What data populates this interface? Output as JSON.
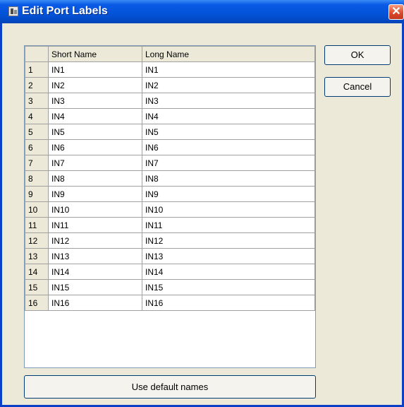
{
  "window": {
    "title": "Edit Port Labels",
    "close_glyph": "✕"
  },
  "table": {
    "headers": {
      "short": "Short Name",
      "long": "Long Name"
    },
    "rows": [
      {
        "num": "1",
        "short": "IN1",
        "long": "IN1"
      },
      {
        "num": "2",
        "short": "IN2",
        "long": "IN2"
      },
      {
        "num": "3",
        "short": "IN3",
        "long": "IN3"
      },
      {
        "num": "4",
        "short": "IN4",
        "long": "IN4"
      },
      {
        "num": "5",
        "short": "IN5",
        "long": "IN5"
      },
      {
        "num": "6",
        "short": "IN6",
        "long": "IN6"
      },
      {
        "num": "7",
        "short": "IN7",
        "long": "IN7"
      },
      {
        "num": "8",
        "short": "IN8",
        "long": "IN8"
      },
      {
        "num": "9",
        "short": "IN9",
        "long": "IN9"
      },
      {
        "num": "10",
        "short": "IN10",
        "long": "IN10"
      },
      {
        "num": "11",
        "short": "IN11",
        "long": "IN11"
      },
      {
        "num": "12",
        "short": "IN12",
        "long": "IN12"
      },
      {
        "num": "13",
        "short": "IN13",
        "long": "IN13"
      },
      {
        "num": "14",
        "short": "IN14",
        "long": "IN14"
      },
      {
        "num": "15",
        "short": "IN15",
        "long": "IN15"
      },
      {
        "num": "16",
        "short": "IN16",
        "long": "IN16"
      }
    ]
  },
  "buttons": {
    "ok": "OK",
    "cancel": "Cancel",
    "default_names": "Use default names"
  }
}
